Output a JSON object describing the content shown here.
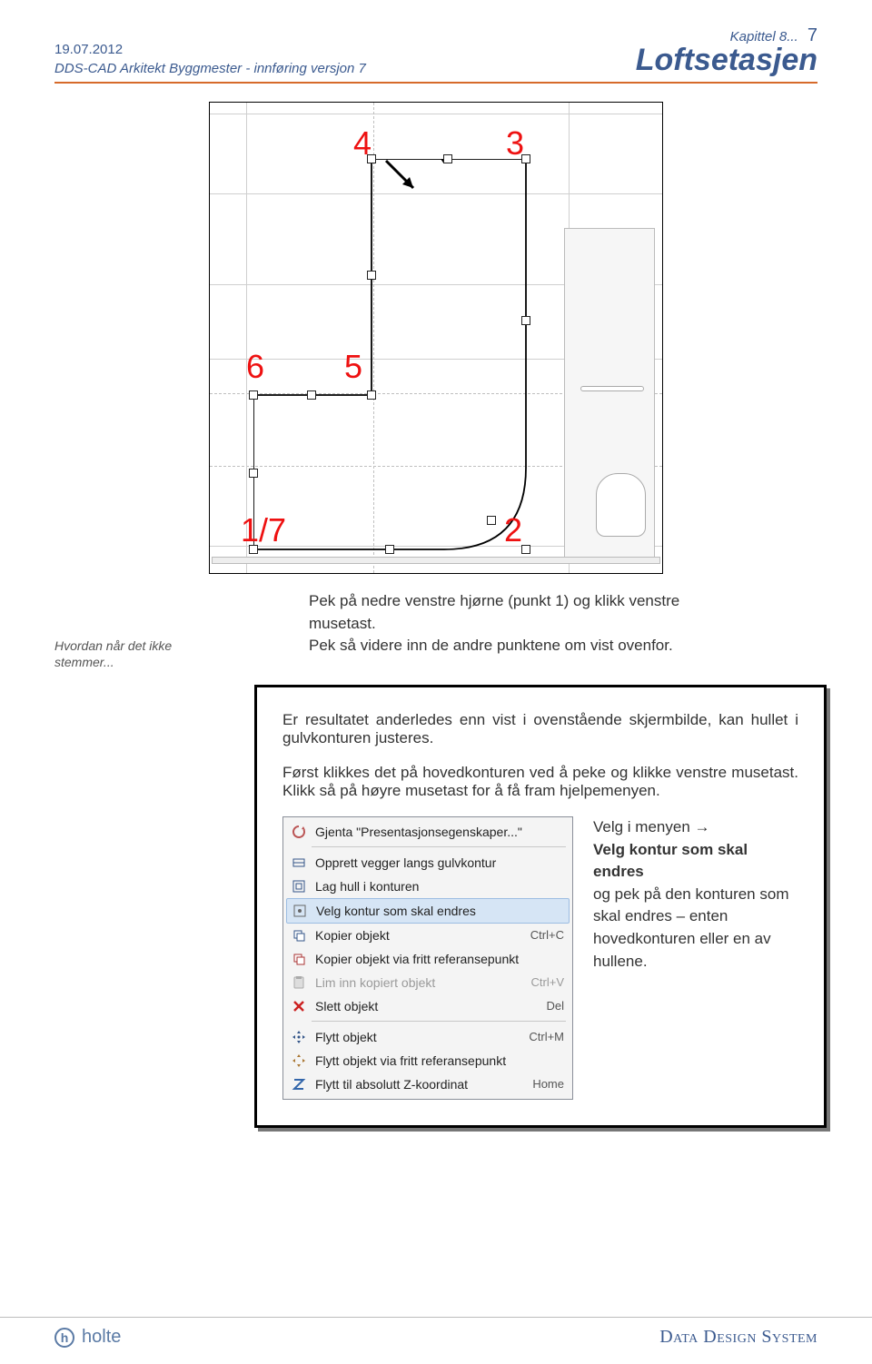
{
  "header": {
    "date": "19.07.2012",
    "subtitle": "DDS-CAD Arkitekt Byggmester -  innføring versjon 7",
    "chapter": "Kapittel 8...",
    "pagenum": "7",
    "title": "Loftsetasjen"
  },
  "diagram": {
    "labels": {
      "n4": "4",
      "n3": "3",
      "n6": "6",
      "n5": "5",
      "n17": "1/7",
      "n2": "2"
    }
  },
  "caption": {
    "line1": "Pek på nedre venstre hjørne (punkt 1) og klikk venstre musetast.",
    "line2": "Pek så videre inn de andre punktene om vist ovenfor."
  },
  "sidenote": "Hvordan når det ikke stemmer...",
  "box": {
    "p1": "Er resultatet anderledes enn vist i ovenstående skjermbilde, kan hullet i gulvkonturen justeres.",
    "p2": "Først klikkes det på hovedkonturen ved å peke og klikke venstre musetast. Klikk så på høyre musetast for å få fram hjelpemenyen.",
    "menu_items": [
      {
        "icon": "refresh-icon",
        "label": "Gjenta \"Presentasjonsegenskaper...\"",
        "shortcut": "",
        "disabled": false
      },
      {
        "sep": true
      },
      {
        "icon": "walls-icon",
        "label": "Opprett vegger langs gulvkontur",
        "shortcut": "",
        "disabled": false
      },
      {
        "icon": "hole-icon",
        "label": "Lag hull i konturen",
        "shortcut": "",
        "disabled": false
      },
      {
        "icon": "contour-icon",
        "label": "Velg kontur som skal endres",
        "shortcut": "",
        "disabled": false,
        "highlight": true
      },
      {
        "icon": "copy-icon",
        "label": "Kopier objekt",
        "shortcut": "Ctrl+C",
        "disabled": false
      },
      {
        "icon": "copyref-icon",
        "label": "Kopier objekt via fritt referansepunkt",
        "shortcut": "",
        "disabled": false
      },
      {
        "icon": "paste-icon",
        "label": "Lim inn kopiert objekt",
        "shortcut": "Ctrl+V",
        "disabled": true
      },
      {
        "icon": "delete-icon",
        "label": "Slett objekt",
        "shortcut": "Del",
        "disabled": false
      },
      {
        "sep": true
      },
      {
        "icon": "move-icon",
        "label": "Flytt objekt",
        "shortcut": "Ctrl+M",
        "disabled": false
      },
      {
        "icon": "moveref-icon",
        "label": "Flytt objekt via fritt referansepunkt",
        "shortcut": "",
        "disabled": false
      },
      {
        "icon": "zmove-icon",
        "label": "Flytt til absolutt Z-koordinat",
        "shortcut": "Home",
        "disabled": false
      }
    ],
    "menu_caption": {
      "l1": "Velg i menyen →",
      "l2": "Velg kontur som skal endres",
      "l3": "og pek på den konturen som skal endres – enten hovedkonturen eller en av hullene."
    }
  },
  "footer": {
    "left": "holte",
    "right": "Data Design System"
  }
}
